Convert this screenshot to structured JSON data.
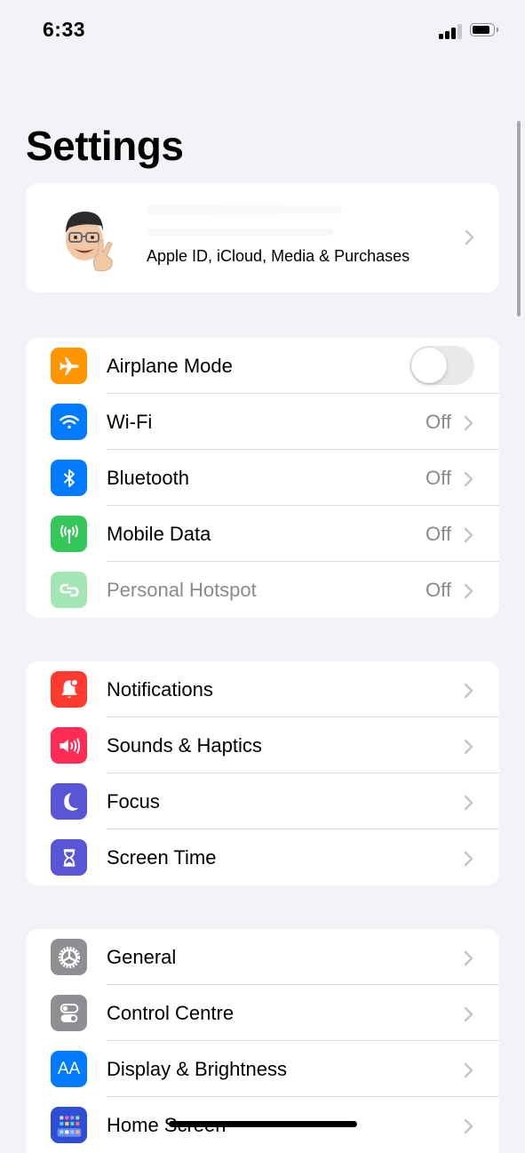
{
  "status_bar": {
    "time": "6:33",
    "signal_bars_active": 3,
    "signal_bars_total": 4,
    "battery_level_percent": 85
  },
  "page": {
    "title": "Settings"
  },
  "profile": {
    "subtitle": "Apple ID, iCloud, Media & Purchases",
    "avatar_icon": "memoji-avatar"
  },
  "groups": [
    {
      "items": [
        {
          "id": "airplane-mode",
          "label": "Airplane Mode",
          "icon": "airplane-icon",
          "color": "#ff9500",
          "control": "toggle",
          "toggle_on": false
        },
        {
          "id": "wifi",
          "label": "Wi-Fi",
          "icon": "wifi-icon",
          "color": "#007aff",
          "value": "Off"
        },
        {
          "id": "bluetooth",
          "label": "Bluetooth",
          "icon": "bluetooth-icon",
          "color": "#007aff",
          "value": "Off"
        },
        {
          "id": "mobile-data",
          "label": "Mobile Data",
          "icon": "antenna-icon",
          "color": "#34c759",
          "value": "Off"
        },
        {
          "id": "personal-hotspot",
          "label": "Personal Hotspot",
          "icon": "hotspot-link-icon",
          "color": "#34c759",
          "value": "Off",
          "disabled": true
        }
      ]
    },
    {
      "items": [
        {
          "id": "notifications",
          "label": "Notifications",
          "icon": "bell-icon",
          "color": "#ff3b30"
        },
        {
          "id": "sounds-haptics",
          "label": "Sounds & Haptics",
          "icon": "speaker-icon",
          "color": "#ff2d55"
        },
        {
          "id": "focus",
          "label": "Focus",
          "icon": "moon-icon",
          "color": "#5856d6"
        },
        {
          "id": "screen-time",
          "label": "Screen Time",
          "icon": "hourglass-icon",
          "color": "#5856d6"
        }
      ]
    },
    {
      "items": [
        {
          "id": "general",
          "label": "General",
          "icon": "gear-icon",
          "color": "#8e8e93"
        },
        {
          "id": "control-centre",
          "label": "Control Centre",
          "icon": "switches-icon",
          "color": "#8e8e93"
        },
        {
          "id": "display-brightness",
          "label": "Display & Brightness",
          "icon": "text-size-icon",
          "color": "#007aff",
          "icon_text": "AA"
        },
        {
          "id": "home-screen",
          "label": "Home Screen",
          "icon": "app-grid-icon",
          "color": "#2c4fd6"
        }
      ]
    }
  ]
}
